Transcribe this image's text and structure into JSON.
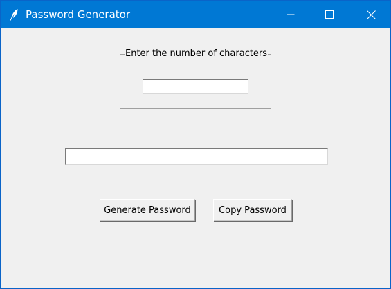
{
  "window": {
    "title": "Password Generator",
    "title_bar_color": "#0078d4",
    "background_color": "#f0f0f0",
    "app_icon": "feather-icon",
    "controls": {
      "minimize_icon": "minimize-icon",
      "maximize_icon": "maximize-icon",
      "close_icon": "close-icon"
    }
  },
  "form": {
    "group_label": "Enter the number of characters",
    "char_count_value": "",
    "password_value": ""
  },
  "buttons": {
    "generate_label": "Generate Password",
    "copy_label": "Copy Password"
  }
}
